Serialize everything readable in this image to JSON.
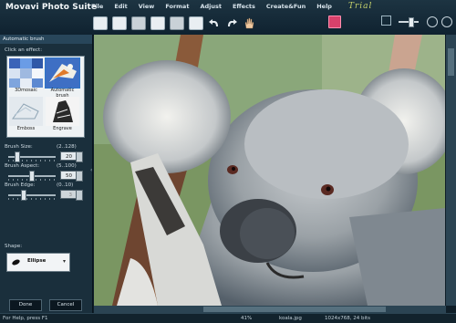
{
  "app": {
    "title": "Movavi Photo Suite",
    "trial_label": "Trial"
  },
  "menu": [
    "File",
    "Edit",
    "View",
    "Format",
    "Adjust",
    "Effects",
    "Create&Fun",
    "Help"
  ],
  "toolbar": {
    "icons": [
      "new-icon",
      "open-icon",
      "print-icon",
      "save-icon",
      "scan-icon",
      "crop-icon",
      "undo-icon",
      "redo-icon",
      "hand-icon",
      "red-eye-icon",
      "fit-icon",
      "zoom-slider",
      "zoom-out-icon",
      "zoom-in-icon"
    ]
  },
  "panel": {
    "title": "Automatic brush",
    "click_effect_label": "Click an effect:",
    "effects": [
      {
        "label": "3Dmosaic",
        "icon": "3dmosaic-thumb"
      },
      {
        "label": "Automatic brush",
        "icon": "automatic-brush-thumb",
        "selected": true
      },
      {
        "label": "Emboss",
        "icon": "emboss-thumb"
      },
      {
        "label": "Engrave",
        "icon": "engrave-thumb"
      }
    ],
    "sliders": [
      {
        "label": "Brush Size:",
        "range": "(2..128)",
        "value": "20",
        "fraction": 0.14,
        "disabled": false
      },
      {
        "label": "Brush Aspect:",
        "range": "(5..100)",
        "value": "50",
        "fraction": 0.47,
        "disabled": false
      },
      {
        "label": "Brush Edge:",
        "range": "(0..10)",
        "value": "3",
        "fraction": 0.3,
        "disabled": true
      }
    ],
    "shape_label": "Shape:",
    "shape_value": "Ellipse",
    "done_label": "Done",
    "cancel_label": "Cancel"
  },
  "status": {
    "help": "For Help, press F1",
    "zoom": "41%",
    "file": "koala.jpg",
    "dims": "1024x768, 24 bits"
  },
  "colors": {
    "accent": "#2f75c9",
    "trial": "#c7d36b",
    "red_eye_button": "#d8416b"
  }
}
